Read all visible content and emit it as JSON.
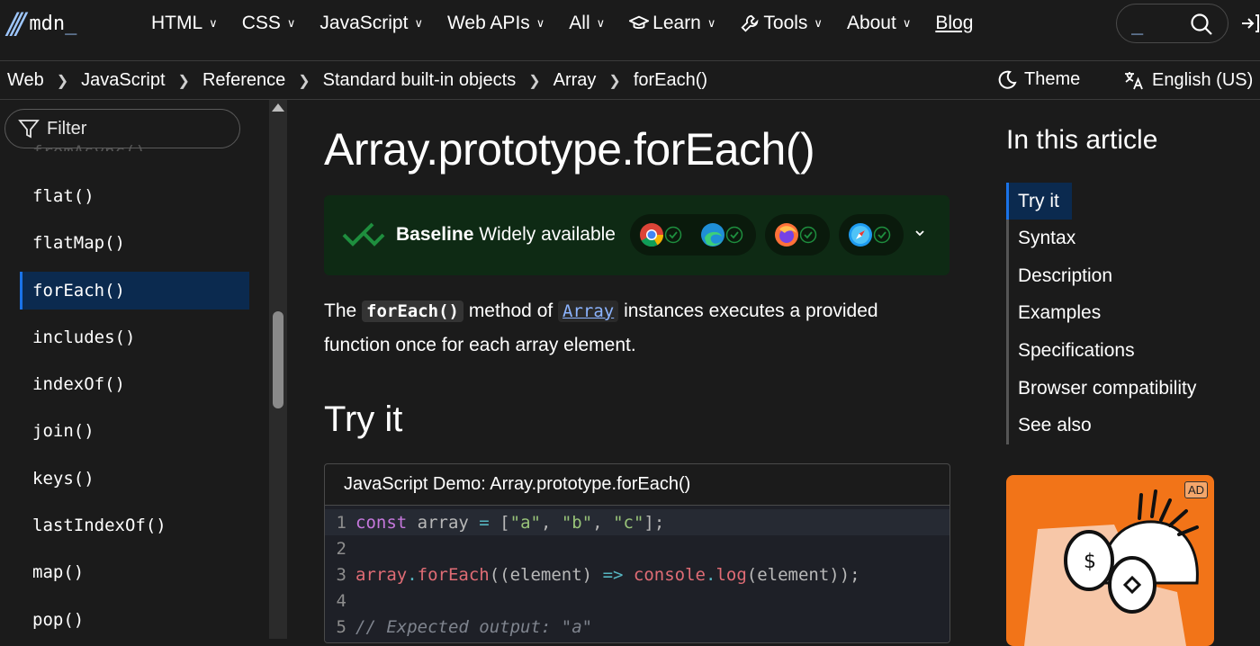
{
  "header": {
    "logo_text": "mdn",
    "logo_cursor": "_",
    "nav": [
      {
        "label": "HTML"
      },
      {
        "label": "CSS"
      },
      {
        "label": "JavaScript"
      },
      {
        "label": "Web APIs"
      },
      {
        "label": "All"
      },
      {
        "label": "Learn"
      },
      {
        "label": "Tools"
      },
      {
        "label": "About"
      }
    ],
    "blog_label": "Blog",
    "search_cursor": "_"
  },
  "breadcrumbs": [
    "Web",
    "JavaScript",
    "Reference",
    "Standard built-in objects",
    "Array",
    "forEach()"
  ],
  "toolbar": {
    "theme_label": "Theme",
    "language_label": "English (US)"
  },
  "sidebar": {
    "filter_placeholder": "Filter",
    "ghost_item": "fromAsync()",
    "items": [
      {
        "label": "flat()"
      },
      {
        "label": "flatMap()"
      },
      {
        "label": "forEach()"
      },
      {
        "label": "includes()"
      },
      {
        "label": "indexOf()"
      },
      {
        "label": "join()"
      },
      {
        "label": "keys()"
      },
      {
        "label": "lastIndexOf()"
      },
      {
        "label": "map()"
      },
      {
        "label": "pop()"
      }
    ],
    "active_index": 2
  },
  "article": {
    "title": "Array.prototype.forEach()",
    "baseline_bold": "Baseline",
    "baseline_rest": " Widely available",
    "intro_pre": "The ",
    "intro_code": "forEach()",
    "intro_mid": " method of ",
    "intro_link": "Array",
    "intro_post": " instances executes a provided function once for each array element.",
    "try_heading": "Try it",
    "demo_title": "JavaScript Demo: Array.prototype.forEach()",
    "code_lines": [
      {
        "num": "1"
      },
      {
        "num": "2"
      },
      {
        "num": "3"
      },
      {
        "num": "4"
      },
      {
        "num": "5"
      }
    ],
    "code_l1": {
      "kw": "const",
      "var": " array ",
      "op": "=",
      "p1": " [",
      "s1": "\"a\"",
      "c1": ", ",
      "s2": "\"b\"",
      "c2": ", ",
      "s3": "\"c\"",
      "p2": "];"
    },
    "code_l3": {
      "obj": "array",
      "dot": ".",
      "fn": "forEach",
      "p1": "((element) ",
      "arrow": "=>",
      "sp": " ",
      "con": "console",
      "dot2": ".",
      "fn2": "log",
      "p2": "(element));"
    },
    "code_l5": "// Expected output: \"a\""
  },
  "toc": {
    "title": "In this article",
    "items": [
      {
        "label": "Try it"
      },
      {
        "label": "Syntax"
      },
      {
        "label": "Description"
      },
      {
        "label": "Examples"
      },
      {
        "label": "Specifications"
      },
      {
        "label": "Browser compatibility"
      },
      {
        "label": "See also"
      }
    ],
    "ad_badge": "AD"
  },
  "colors": {
    "accent": "#1a73e8",
    "baseline_bg": "#0e2a14",
    "ad_bg": "#f27418"
  }
}
